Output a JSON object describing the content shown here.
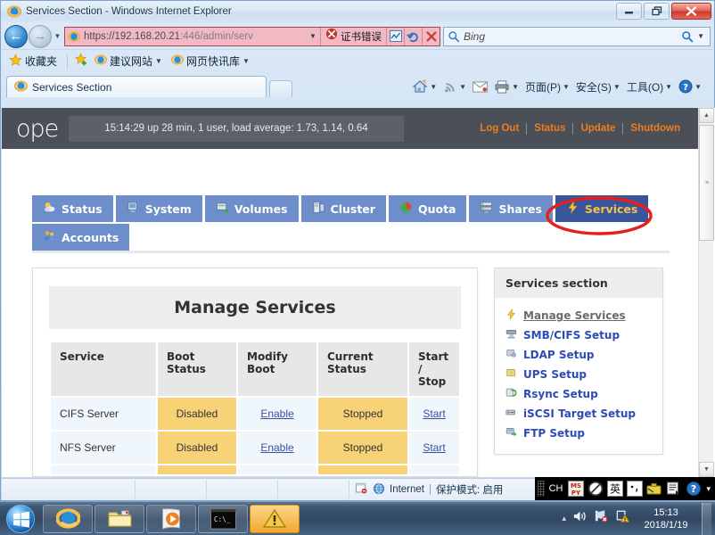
{
  "window": {
    "title": "Services Section - Windows Internet Explorer",
    "minimize_label": "–",
    "restore_label": "❐",
    "close_label": "✕"
  },
  "browser": {
    "back_label": "←",
    "forward_label": "→",
    "recent_pages_label": "▼",
    "address": {
      "url_visible": "https://192.168.20.21",
      "url_rest": ":446/admin/serv",
      "dropdown_label": "▼",
      "cert_error_label": "证书错误",
      "stop_label": "✕",
      "refresh_label": "↻"
    },
    "search": {
      "placeholder": "Bing",
      "go_label": "▼"
    },
    "favorites_bar": {
      "favorites_label": "收藏夹",
      "items": [
        {
          "label": "建议网站",
          "caret": "▼"
        },
        {
          "label": "网页快讯库",
          "caret": "▼"
        }
      ]
    },
    "tab": {
      "label": "Services Section"
    },
    "new_tab_label": "",
    "command_bar": {
      "home_caret": "▼",
      "feeds_caret": "▼",
      "print_caret": "▼",
      "items": [
        {
          "label": "页面(P)",
          "caret": "▼"
        },
        {
          "label": "安全(S)",
          "caret": "▼"
        },
        {
          "label": "工具(O)",
          "caret": "▼"
        }
      ],
      "help_caret": "▼"
    },
    "status_bar": {
      "zone_label": "Internet",
      "separator": "|",
      "protected_mode": "保护模式: 启用"
    },
    "scrollbar": {
      "up_label": "▲",
      "down_label": "▼",
      "grip_label": "≡",
      "h_grip_label": "≡"
    }
  },
  "page": {
    "header": {
      "logo_text": "ope",
      "uptime": "15:14:29 up 28 min, 1 user, load average: 1.73, 1.14, 0.64",
      "links": [
        "Log Out",
        "Status",
        "Update",
        "Shutdown"
      ]
    },
    "nav_tabs_row1": [
      {
        "label": "Status",
        "icon": "weather-sun-icon",
        "active": false
      },
      {
        "label": "System",
        "icon": "monitor-icon",
        "active": false
      },
      {
        "label": "Volumes",
        "icon": "disk-arrow-icon",
        "active": false
      },
      {
        "label": "Cluster",
        "icon": "cluster-icon",
        "active": false
      },
      {
        "label": "Quota",
        "icon": "pie-chart-icon",
        "active": false
      },
      {
        "label": "Shares",
        "icon": "server-share-icon",
        "active": false
      },
      {
        "label": "Services",
        "icon": "lightning-icon",
        "active": true
      }
    ],
    "nav_tabs_row2": [
      {
        "label": "Accounts",
        "icon": "users-icon",
        "active": false
      }
    ],
    "main": {
      "card_title": "Manage Services",
      "table": {
        "columns": [
          "Service",
          "Boot Status",
          "Modify Boot",
          "Current Status",
          "Start / Stop"
        ],
        "rows": [
          {
            "service": "CIFS Server",
            "boot_status": "Disabled",
            "modify_boot": "Enable",
            "current_status": "Stopped",
            "start_stop": "Start"
          },
          {
            "service": "NFS Server",
            "boot_status": "Disabled",
            "modify_boot": "Enable",
            "current_status": "Stopped",
            "start_stop": "Start"
          },
          {
            "service": "",
            "boot_status": "",
            "modify_boot": "",
            "current_status": "",
            "start_stop": ""
          }
        ]
      }
    },
    "sidebar": {
      "title": "Services section",
      "links": [
        {
          "label": "Manage Services",
          "icon": "lightning-icon",
          "current": true
        },
        {
          "label": "SMB/CIFS Setup",
          "icon": "server-icon",
          "current": false
        },
        {
          "label": "LDAP Setup",
          "icon": "directory-icon",
          "current": false
        },
        {
          "label": "UPS Setup",
          "icon": "power-icon",
          "current": false
        },
        {
          "label": "Rsync Setup",
          "icon": "sync-icon",
          "current": false
        },
        {
          "label": "iSCSI Target Setup",
          "icon": "target-icon",
          "current": false
        },
        {
          "label": "FTP Setup",
          "icon": "transfer-icon",
          "current": false
        }
      ]
    },
    "annotation": {
      "shape": "ellipse",
      "color": "#e81e1e",
      "targets": "Services"
    }
  },
  "ime": {
    "lang_code": "CH",
    "engine_label": "MSPY",
    "mode_label": "英",
    "punct_label": "・,",
    "more_label": "▾"
  },
  "taskbar": {
    "start_label": "",
    "buttons": [
      {
        "name": "internet-explorer",
        "label": ""
      },
      {
        "name": "windows-explorer",
        "label": ""
      },
      {
        "name": "media-player",
        "label": ""
      },
      {
        "name": "command-prompt",
        "label": "C:\\_"
      },
      {
        "name": "warning-app",
        "label": "!"
      }
    ],
    "tray": {
      "expand_label": "▴"
    },
    "clock": {
      "time": "15:13",
      "date": "2018/1/19"
    }
  },
  "colors": {
    "accent_orange": "#f07d1a",
    "tab_blue": "#6d8ecb",
    "tab_active_blue": "#39569c",
    "warn_yellow": "#f7d276",
    "link_blue": "#2c4bb5",
    "annotation_red": "#e81e1e"
  }
}
